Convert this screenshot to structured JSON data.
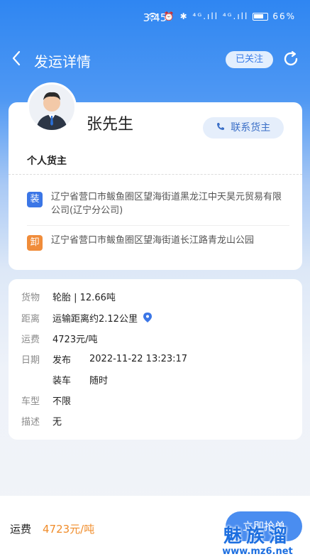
{
  "status_bar": {
    "time": "3:45",
    "icons_text": "👁 ⏰ ✱ ⁴ᴳ.ıll ⁴ᴳ.ıll",
    "battery": "66%"
  },
  "nav": {
    "title": "发运详情",
    "follow_label": "已关注"
  },
  "owner": {
    "name": "张先生",
    "contact_label": "联系货主",
    "type": "个人货主"
  },
  "route": {
    "load_badge": "装",
    "load_address": "辽宁省营口市鲅鱼圈区望海街道黑龙江中天昊元贸易有限公司(辽宁分公司)",
    "unload_badge": "卸",
    "unload_address": "辽宁省营口市鲅鱼圈区望海街道长江路青龙山公园"
  },
  "details": {
    "cargo_label": "货物",
    "cargo_value": "轮胎 | 12.66吨",
    "distance_label": "距离",
    "distance_value": "运输距离约2.12公里",
    "freight_label": "运费",
    "freight_value": "4723元/吨",
    "date_label": "日期",
    "publish_label": "发布",
    "publish_value": "2022-11-22 13:23:17",
    "loading_label": "装车",
    "loading_value": "随时",
    "vehicle_label": "车型",
    "vehicle_value": "不限",
    "desc_label": "描述",
    "desc_value": "无"
  },
  "bottom": {
    "fee_label": "运费",
    "fee_value": "4723元/吨",
    "grab_label": "立即抢单"
  },
  "watermark": {
    "title": "魅族溜",
    "url": "www.mz6.net"
  },
  "colors": {
    "primary": "#3b7de9",
    "accent_orange": "#f08c2a",
    "load_badge": "#3b76e6",
    "unload_badge": "#f08c3a"
  }
}
